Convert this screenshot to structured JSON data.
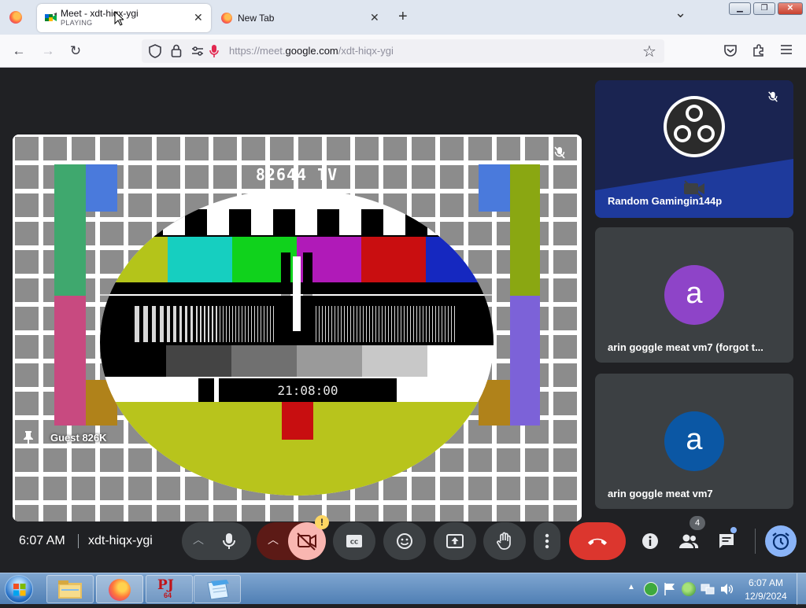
{
  "browser": {
    "tabs": [
      {
        "title": "Meet - xdt-hiqx-ygi",
        "status": "PLAYING",
        "close": "✕"
      },
      {
        "title": "New Tab",
        "close": "✕"
      }
    ],
    "new_tab_label": "+",
    "tab_list_label": "⌄",
    "window_controls": {
      "minimize": "▁",
      "restore": "❐",
      "close": "✕"
    },
    "url": {
      "scheme": "https://meet.",
      "host": "google.com",
      "path": "/xdt-hiqx-ygi"
    }
  },
  "meet": {
    "main_video": {
      "participant": "Guest 826K",
      "overlay_title": "82644 TV",
      "overlay_time": "21:08:00"
    },
    "participants": [
      {
        "name": "Random Gamingin144p",
        "muted": true
      },
      {
        "name": "arin goggle meat vm7 (forgot t...",
        "avatar_letter": "a",
        "avatar_color": "#8e44c8"
      },
      {
        "name": "arin goggle meat vm7",
        "avatar_letter": "a",
        "avatar_color": "#0b57a4"
      }
    ],
    "controls": {
      "time": "6:07 AM",
      "meeting_code": "xdt-hiqx-ygi",
      "people_count": "4",
      "camera_warning": "!"
    }
  },
  "taskbar": {
    "time": "6:07 AM",
    "date": "12/9/2024",
    "pj64_label": "PJ",
    "pj64_sub": "64"
  }
}
